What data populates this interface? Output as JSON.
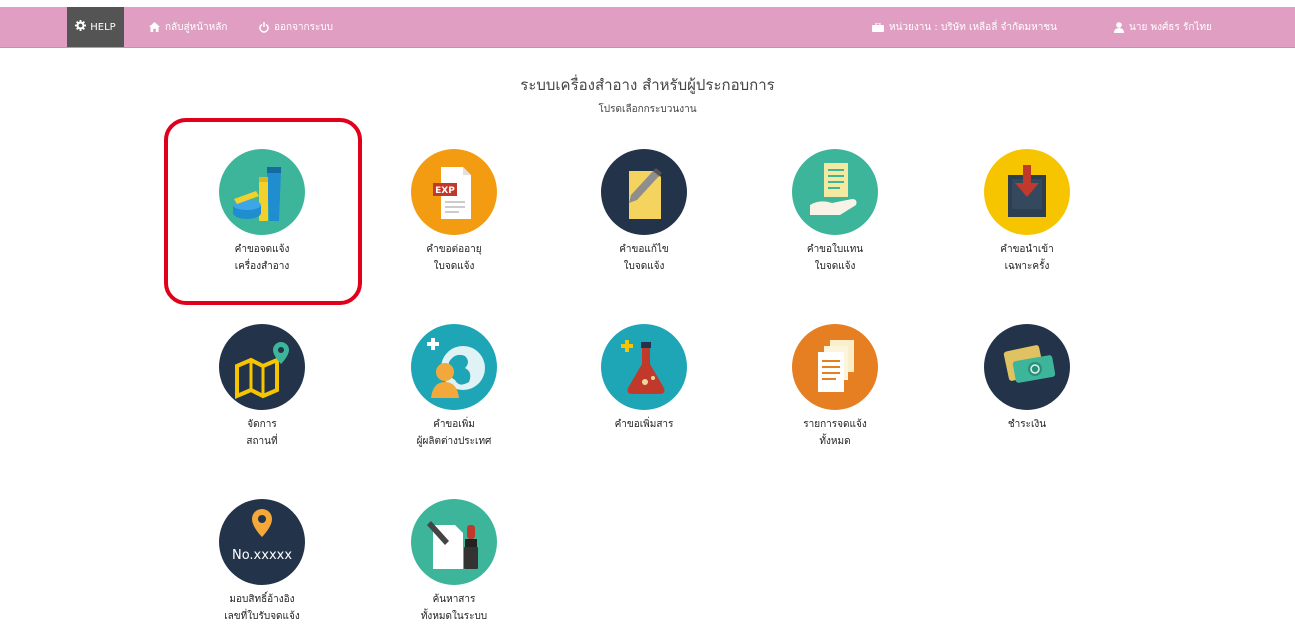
{
  "topbar": {
    "help_label": "HELP",
    "home_label": "กลับสู่หน้าหลัก",
    "logout_label": "ออกจากระบบ",
    "org_label": "หน่วยงาน : บริษัท เหลือลี่ จำกัดมหาชน",
    "user_label": "นาย พงศ์ธร รักไทย"
  },
  "header": {
    "title": "ระบบเครื่องสำอาง สำหรับผู้ประกอบการ",
    "subtitle": "โปรดเลือกกระบวนงาน"
  },
  "tiles": [
    {
      "line1": "คำขอจดแจ้ง",
      "line2": "เครื่องสำอาง"
    },
    {
      "line1": "คำขอต่ออายุ",
      "line2": "ใบจดแจ้ง"
    },
    {
      "line1": "คำขอแก้ไข",
      "line2": "ใบจดแจ้ง"
    },
    {
      "line1": "คำขอใบแทน",
      "line2": "ใบจดแจ้ง"
    },
    {
      "line1": "คำขอนำเข้า",
      "line2": "เฉพาะครั้ง"
    },
    {
      "line1": "จัดการ",
      "line2": "สถานที่"
    },
    {
      "line1": "คำขอเพิ่ม",
      "line2": "ผู้ผลิตต่างประเทศ"
    },
    {
      "line1": "คำขอเพิ่มสาร",
      "line2": ""
    },
    {
      "line1": "รายการจดแจ้ง",
      "line2": "ทั้งหมด"
    },
    {
      "line1": "ชำระเงิน",
      "line2": ""
    },
    {
      "line1": "มอบสิทธิ์อ้างอิง",
      "line2": "เลขที่ใบรับจดแจ้ง"
    },
    {
      "line1": "ค้นหาสาร",
      "line2": "ทั้งหมดในระบบ"
    }
  ],
  "icons": {
    "exp_text": "EXP",
    "no_text": "No.xxxxx",
    "names": [
      "cosmetics-icon",
      "renew-icon",
      "edit-icon",
      "replacement-icon",
      "import-icon",
      "location-icon",
      "add-manufacturer-icon",
      "add-substance-icon",
      "notifications-list-icon",
      "payment-icon",
      "reference-rights-icon",
      "search-substance-icon"
    ]
  },
  "colors": {
    "topbar": "#e09fc2",
    "help_bg": "#545454",
    "highlight": "#e0001b",
    "teal": "#3db59a",
    "orange": "#f39c12",
    "navy": "#22334a",
    "yellow": "#f6c500",
    "cyan": "#1fa6b6"
  }
}
